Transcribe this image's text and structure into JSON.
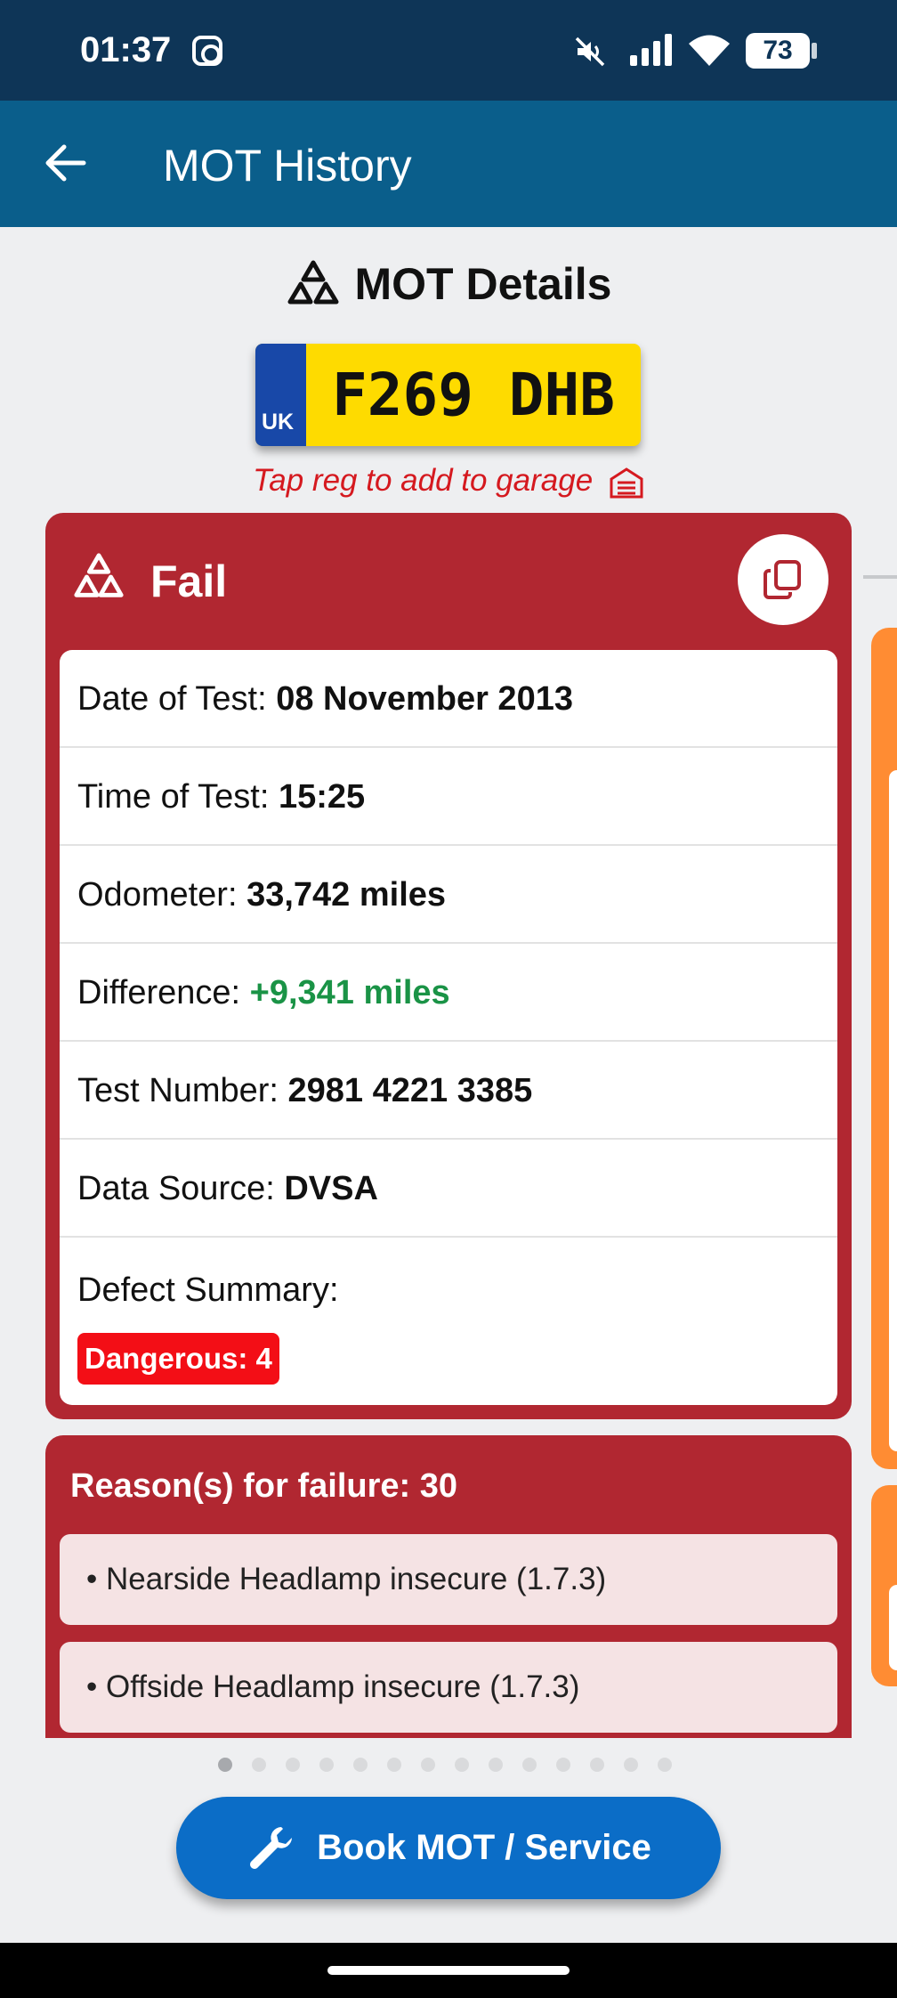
{
  "status_bar": {
    "time": "01:37",
    "battery": "73",
    "icons": [
      "instagram-icon",
      "mute-icon",
      "signal-icon",
      "wifi-icon",
      "battery-icon"
    ]
  },
  "app_bar": {
    "title": "MOT History",
    "back_icon": "arrow-left-icon"
  },
  "details": {
    "title": "MOT Details",
    "icon": "mot-triangles-icon"
  },
  "plate": {
    "country": "UK",
    "registration": "F269 DHB"
  },
  "tap_hint": {
    "text": "Tap reg to add to garage",
    "icon": "garage-icon"
  },
  "test_result": {
    "status": "Fail",
    "copy_icon": "copy-icon",
    "colors": {
      "card": "#b12731",
      "badge": "#f30e16",
      "difference": "#1a9346"
    },
    "rows": [
      {
        "label": "Date of Test:",
        "value": "08 November 2013"
      },
      {
        "label": "Time of Test:",
        "value": "15:25"
      },
      {
        "label": "Odometer:",
        "value": "33,742 miles"
      },
      {
        "label": "Difference:",
        "value": "+9,341 miles"
      },
      {
        "label": "Test Number:",
        "value": "2981 4221 3385"
      },
      {
        "label": "Data Source:",
        "value": "DVSA"
      }
    ],
    "defect_summary": {
      "label": "Defect Summary:",
      "badge": "Dangerous: 4"
    }
  },
  "reasons": {
    "title": "Reason(s) for failure: 30",
    "items": [
      "• Nearside Headlamp insecure (1.7.3)",
      "• Offside Headlamp insecure (1.7.3)"
    ]
  },
  "pagination": {
    "total": 14,
    "active": 1
  },
  "book_button": {
    "label": "Book MOT / Service",
    "icon": "wrench-icon",
    "color": "#0b6dc7"
  }
}
